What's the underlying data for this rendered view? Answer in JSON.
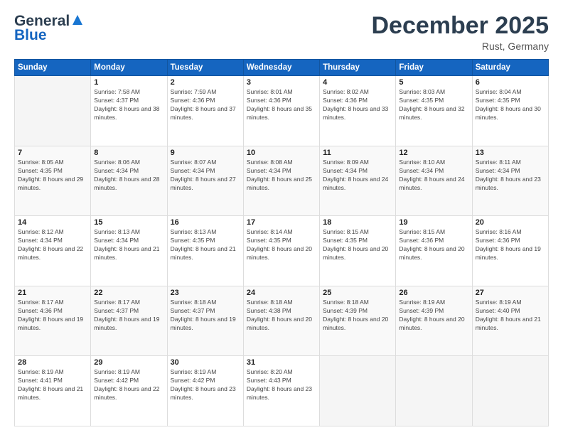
{
  "logo": {
    "line1": "General",
    "line2": "Blue"
  },
  "title": "December 2025",
  "location": "Rust, Germany",
  "header": {
    "days": [
      "Sunday",
      "Monday",
      "Tuesday",
      "Wednesday",
      "Thursday",
      "Friday",
      "Saturday"
    ]
  },
  "weeks": [
    [
      {
        "day": "",
        "sunrise": "",
        "sunset": "",
        "daylight": ""
      },
      {
        "day": "1",
        "sunrise": "Sunrise: 7:58 AM",
        "sunset": "Sunset: 4:37 PM",
        "daylight": "Daylight: 8 hours and 38 minutes."
      },
      {
        "day": "2",
        "sunrise": "Sunrise: 7:59 AM",
        "sunset": "Sunset: 4:36 PM",
        "daylight": "Daylight: 8 hours and 37 minutes."
      },
      {
        "day": "3",
        "sunrise": "Sunrise: 8:01 AM",
        "sunset": "Sunset: 4:36 PM",
        "daylight": "Daylight: 8 hours and 35 minutes."
      },
      {
        "day": "4",
        "sunrise": "Sunrise: 8:02 AM",
        "sunset": "Sunset: 4:36 PM",
        "daylight": "Daylight: 8 hours and 33 minutes."
      },
      {
        "day": "5",
        "sunrise": "Sunrise: 8:03 AM",
        "sunset": "Sunset: 4:35 PM",
        "daylight": "Daylight: 8 hours and 32 minutes."
      },
      {
        "day": "6",
        "sunrise": "Sunrise: 8:04 AM",
        "sunset": "Sunset: 4:35 PM",
        "daylight": "Daylight: 8 hours and 30 minutes."
      }
    ],
    [
      {
        "day": "7",
        "sunrise": "Sunrise: 8:05 AM",
        "sunset": "Sunset: 4:35 PM",
        "daylight": "Daylight: 8 hours and 29 minutes."
      },
      {
        "day": "8",
        "sunrise": "Sunrise: 8:06 AM",
        "sunset": "Sunset: 4:34 PM",
        "daylight": "Daylight: 8 hours and 28 minutes."
      },
      {
        "day": "9",
        "sunrise": "Sunrise: 8:07 AM",
        "sunset": "Sunset: 4:34 PM",
        "daylight": "Daylight: 8 hours and 27 minutes."
      },
      {
        "day": "10",
        "sunrise": "Sunrise: 8:08 AM",
        "sunset": "Sunset: 4:34 PM",
        "daylight": "Daylight: 8 hours and 25 minutes."
      },
      {
        "day": "11",
        "sunrise": "Sunrise: 8:09 AM",
        "sunset": "Sunset: 4:34 PM",
        "daylight": "Daylight: 8 hours and 24 minutes."
      },
      {
        "day": "12",
        "sunrise": "Sunrise: 8:10 AM",
        "sunset": "Sunset: 4:34 PM",
        "daylight": "Daylight: 8 hours and 24 minutes."
      },
      {
        "day": "13",
        "sunrise": "Sunrise: 8:11 AM",
        "sunset": "Sunset: 4:34 PM",
        "daylight": "Daylight: 8 hours and 23 minutes."
      }
    ],
    [
      {
        "day": "14",
        "sunrise": "Sunrise: 8:12 AM",
        "sunset": "Sunset: 4:34 PM",
        "daylight": "Daylight: 8 hours and 22 minutes."
      },
      {
        "day": "15",
        "sunrise": "Sunrise: 8:13 AM",
        "sunset": "Sunset: 4:34 PM",
        "daylight": "Daylight: 8 hours and 21 minutes."
      },
      {
        "day": "16",
        "sunrise": "Sunrise: 8:13 AM",
        "sunset": "Sunset: 4:35 PM",
        "daylight": "Daylight: 8 hours and 21 minutes."
      },
      {
        "day": "17",
        "sunrise": "Sunrise: 8:14 AM",
        "sunset": "Sunset: 4:35 PM",
        "daylight": "Daylight: 8 hours and 20 minutes."
      },
      {
        "day": "18",
        "sunrise": "Sunrise: 8:15 AM",
        "sunset": "Sunset: 4:35 PM",
        "daylight": "Daylight: 8 hours and 20 minutes."
      },
      {
        "day": "19",
        "sunrise": "Sunrise: 8:15 AM",
        "sunset": "Sunset: 4:36 PM",
        "daylight": "Daylight: 8 hours and 20 minutes."
      },
      {
        "day": "20",
        "sunrise": "Sunrise: 8:16 AM",
        "sunset": "Sunset: 4:36 PM",
        "daylight": "Daylight: 8 hours and 19 minutes."
      }
    ],
    [
      {
        "day": "21",
        "sunrise": "Sunrise: 8:17 AM",
        "sunset": "Sunset: 4:36 PM",
        "daylight": "Daylight: 8 hours and 19 minutes."
      },
      {
        "day": "22",
        "sunrise": "Sunrise: 8:17 AM",
        "sunset": "Sunset: 4:37 PM",
        "daylight": "Daylight: 8 hours and 19 minutes."
      },
      {
        "day": "23",
        "sunrise": "Sunrise: 8:18 AM",
        "sunset": "Sunset: 4:37 PM",
        "daylight": "Daylight: 8 hours and 19 minutes."
      },
      {
        "day": "24",
        "sunrise": "Sunrise: 8:18 AM",
        "sunset": "Sunset: 4:38 PM",
        "daylight": "Daylight: 8 hours and 20 minutes."
      },
      {
        "day": "25",
        "sunrise": "Sunrise: 8:18 AM",
        "sunset": "Sunset: 4:39 PM",
        "daylight": "Daylight: 8 hours and 20 minutes."
      },
      {
        "day": "26",
        "sunrise": "Sunrise: 8:19 AM",
        "sunset": "Sunset: 4:39 PM",
        "daylight": "Daylight: 8 hours and 20 minutes."
      },
      {
        "day": "27",
        "sunrise": "Sunrise: 8:19 AM",
        "sunset": "Sunset: 4:40 PM",
        "daylight": "Daylight: 8 hours and 21 minutes."
      }
    ],
    [
      {
        "day": "28",
        "sunrise": "Sunrise: 8:19 AM",
        "sunset": "Sunset: 4:41 PM",
        "daylight": "Daylight: 8 hours and 21 minutes."
      },
      {
        "day": "29",
        "sunrise": "Sunrise: 8:19 AM",
        "sunset": "Sunset: 4:42 PM",
        "daylight": "Daylight: 8 hours and 22 minutes."
      },
      {
        "day": "30",
        "sunrise": "Sunrise: 8:19 AM",
        "sunset": "Sunset: 4:42 PM",
        "daylight": "Daylight: 8 hours and 23 minutes."
      },
      {
        "day": "31",
        "sunrise": "Sunrise: 8:20 AM",
        "sunset": "Sunset: 4:43 PM",
        "daylight": "Daylight: 8 hours and 23 minutes."
      },
      {
        "day": "",
        "sunrise": "",
        "sunset": "",
        "daylight": ""
      },
      {
        "day": "",
        "sunrise": "",
        "sunset": "",
        "daylight": ""
      },
      {
        "day": "",
        "sunrise": "",
        "sunset": "",
        "daylight": ""
      }
    ]
  ]
}
